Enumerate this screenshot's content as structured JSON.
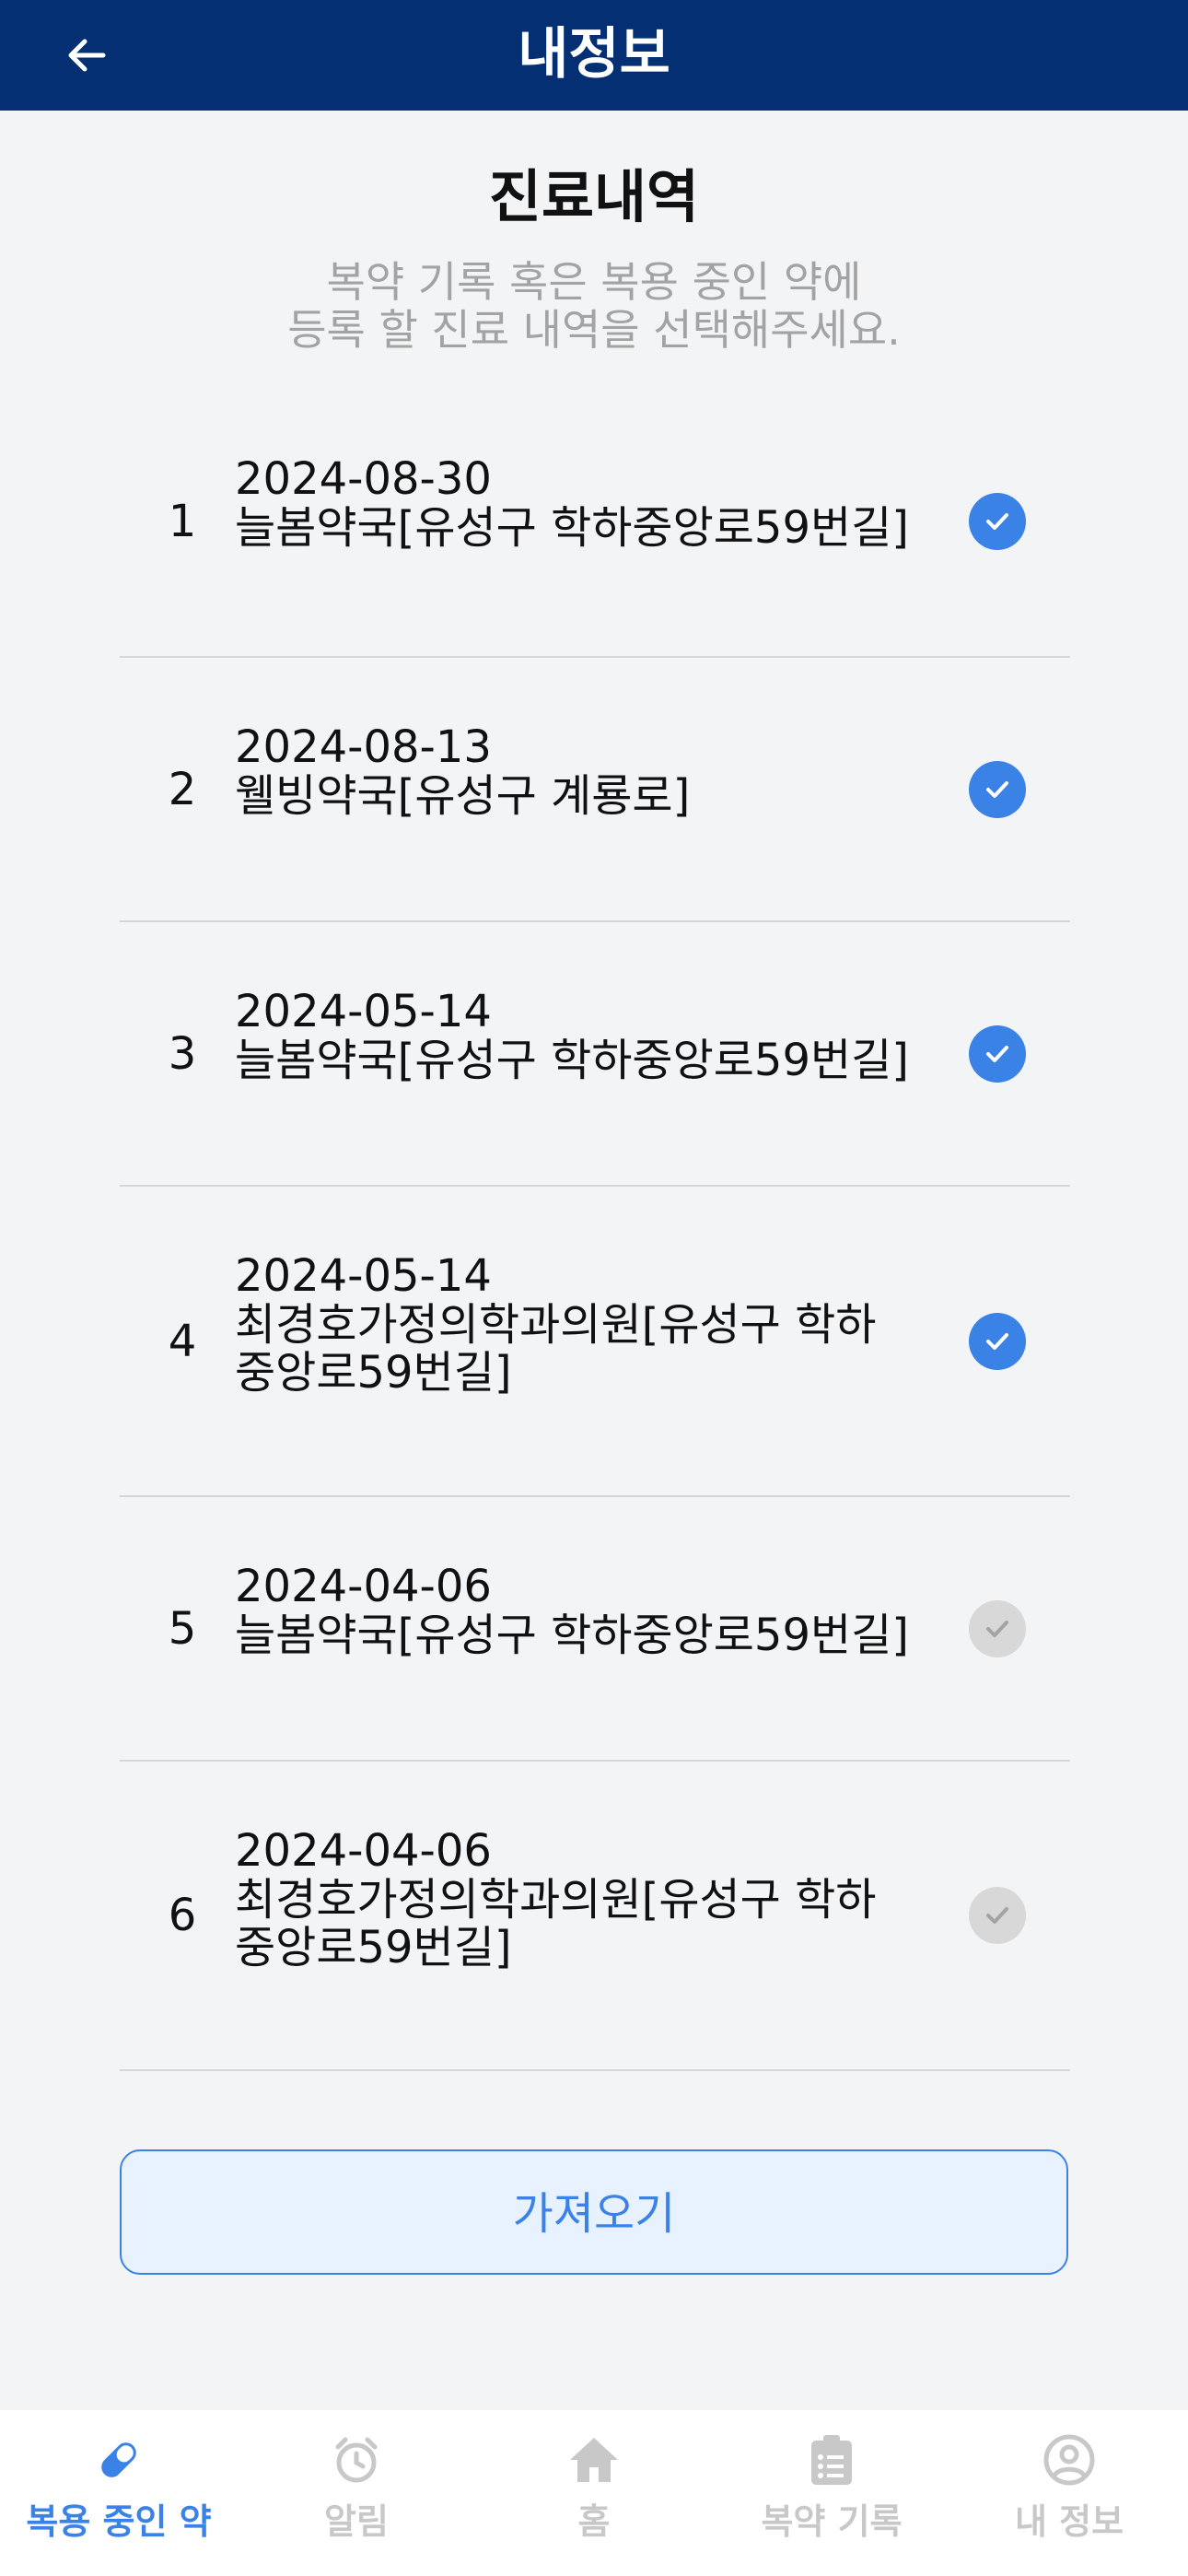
{
  "header": {
    "title": "내정보"
  },
  "main": {
    "title": "진료내역",
    "subtitle_line1": "복약 기록 혹은 복용 중인 약에",
    "subtitle_line2": "등록 할 진료 내역을 선택해주세요."
  },
  "records": [
    {
      "index": "1",
      "date": "2024-08-30",
      "place_line1": "늘봄약국[유성구 학하중앙로59번길]",
      "place_line2": "",
      "checked": true
    },
    {
      "index": "2",
      "date": "2024-08-13",
      "place_line1": "웰빙약국[유성구 계룡로]",
      "place_line2": "",
      "checked": true
    },
    {
      "index": "3",
      "date": "2024-05-14",
      "place_line1": "늘봄약국[유성구 학하중앙로59번길]",
      "place_line2": "",
      "checked": true
    },
    {
      "index": "4",
      "date": "2024-05-14",
      "place_line1": "최경호가정의학과의원[유성구 학하",
      "place_line2": "중앙로59번길]",
      "checked": true
    },
    {
      "index": "5",
      "date": "2024-04-06",
      "place_line1": "늘봄약국[유성구 학하중앙로59번길]",
      "place_line2": "",
      "checked": false
    },
    {
      "index": "6",
      "date": "2024-04-06",
      "place_line1": "최경호가정의학과의원[유성구 학하",
      "place_line2": "중앙로59번길]",
      "checked": false
    }
  ],
  "actions": {
    "fetch_label": "가져오기"
  },
  "bottom_nav": [
    {
      "label": "복용 중인 약",
      "icon": "pill-icon",
      "active": true
    },
    {
      "label": "알림",
      "icon": "alarm-clock-icon",
      "active": false
    },
    {
      "label": "홈",
      "icon": "home-icon",
      "active": false
    },
    {
      "label": "복약 기록",
      "icon": "clipboard-icon",
      "active": false
    },
    {
      "label": "내 정보",
      "icon": "user-circle-icon",
      "active": false
    }
  ],
  "colors": {
    "header_bg": "#042f73",
    "accent": "#3a82e6",
    "inactive": "#c8c8c8"
  }
}
